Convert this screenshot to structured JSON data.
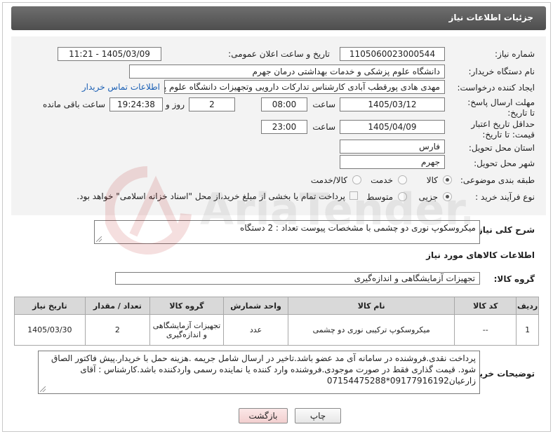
{
  "header": {
    "title": "جزئیات اطلاعات نیاز"
  },
  "fields": {
    "need_number_label": "شماره نیاز:",
    "need_number": "1105060023000544",
    "announce_label": "تاریخ و ساعت اعلان عمومی:",
    "announce_value": "1405/03/09 - 11:21",
    "buyer_org_label": "نام دستگاه خریدار:",
    "buyer_org": "دانشگاه علوم پزشکی و خدمات بهداشتی  درمان جهرم",
    "creator_label": "ایجاد کننده درخواست:",
    "creator": "مهدی هادی پورقطب آبادی کارشناس تدارکات دارویی وتجهیزات دانشگاه علوم پز",
    "contact_link": "اطلاعات تماس خریدار",
    "reply_deadline_label": "مهلت ارسال پاسخ: تا تاریخ:",
    "reply_date": "1405/03/12",
    "time_label": "ساعت",
    "reply_time": "08:00",
    "days_value": "2",
    "days_label": "روز و",
    "remaining_time": "19:24:38",
    "remaining_label": "ساعت باقی مانده",
    "price_deadline_label": "حداقل تاریخ اعتبار قیمت: تا تاریخ:",
    "price_date": "1405/04/09",
    "price_time": "23:00",
    "province_label": "استان محل تحویل:",
    "province": "فارس",
    "city_label": "شهر محل تحویل:",
    "city": "جهرم",
    "category_label": "طبقه بندی موضوعی:",
    "category_options": [
      "کالا",
      "خدمت",
      "کالا/خدمت"
    ],
    "process_label": "نوع فرآیند خرید :",
    "process_options": [
      "جزیی",
      "متوسط"
    ],
    "payment_note": "پرداخت تمام یا بخشی از مبلغ خرید،از محل \"اسناد خزانه اسلامی\" خواهد بود."
  },
  "summary": {
    "label": "شرح کلی نیاز:",
    "value": "میکروسکوپ نوری دو چشمی با مشخصات پیوست        تعداد : 2 دستگاه"
  },
  "goods": {
    "section_title": "اطلاعات کالاهای مورد نیاز",
    "group_label": "گروه کالا:",
    "group_value": "تجهیزات آزمایشگاهی و اندازه‌گیری",
    "columns": [
      "ردیف",
      "کد کالا",
      "نام کالا",
      "واحد شمارش",
      "گروه کالا",
      "تعداد / مقدار",
      "تاریخ نیاز"
    ],
    "rows": [
      {
        "row": "1",
        "code": "--",
        "name": "میکروسکوپ ترکیبی نوری دو چشمی",
        "unit": "عدد",
        "group": "تجهیزات آزمایشگاهی و اندازه‌گیری",
        "qty": "2",
        "date": "1405/03/30"
      }
    ]
  },
  "buyer_notes": {
    "label": "توضیحات خریدار:",
    "value": "پرداخت نقدی.فروشنده در سامانه آی مد عضو باشد.تاخیر در ارسال شامل جریمه .هزینه حمل با خریدار.پیش فاکتور الصاق شود. قیمت گذاری فقط در صورت موجودی.فروشنده وارد کننده یا نماینده رسمی واردکننده باشد.کارشناس : آقای زارعیان09177916192*07154475288"
  },
  "buttons": {
    "print": "چاپ",
    "back": "بازگشت"
  },
  "watermark_text": "AriaTender.neT",
  "colors": {
    "header": "#5a5a5a",
    "panel": "#f3f3f3",
    "link": "#1a5fb4",
    "back_button": "#f6d8d8"
  }
}
